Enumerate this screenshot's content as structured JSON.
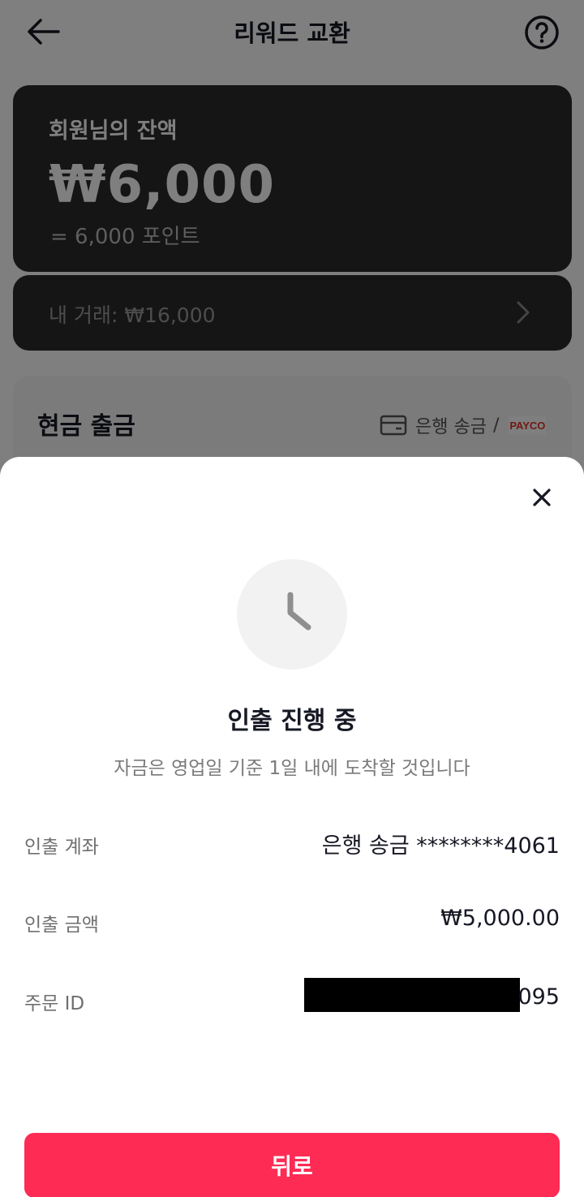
{
  "header": {
    "title": "리워드 교환",
    "back_icon": "arrow-left-icon",
    "help_icon": "question-circle-icon"
  },
  "balance": {
    "label": "회원님의 잔액",
    "amount": "₩6,000",
    "points": "= 6,000 포인트"
  },
  "transactions": {
    "label": "내 거래: ₩16,000",
    "chevron_icon": "chevron-right-icon"
  },
  "withdraw": {
    "title": "현금 출금",
    "method_bank": "은행 송금",
    "separator": "/",
    "method_payco": "PAYCO"
  },
  "sheet": {
    "status_icon": "clock-icon",
    "status_title": "인출 진행 중",
    "status_desc": "자금은 영업일 기준 1일 내에 도착할 것입니다",
    "details": {
      "account_label": "인출 계좌",
      "account_value": "은행 송금 ********4061",
      "amount_label": "인출 금액",
      "amount_value": "₩5,000.00",
      "order_label": "주문 ID",
      "order_value": "095"
    },
    "back_button": "뒤로"
  },
  "colors": {
    "accent": "#fe2c55",
    "text_primary": "#161823",
    "text_secondary": "#7a7a7a"
  }
}
